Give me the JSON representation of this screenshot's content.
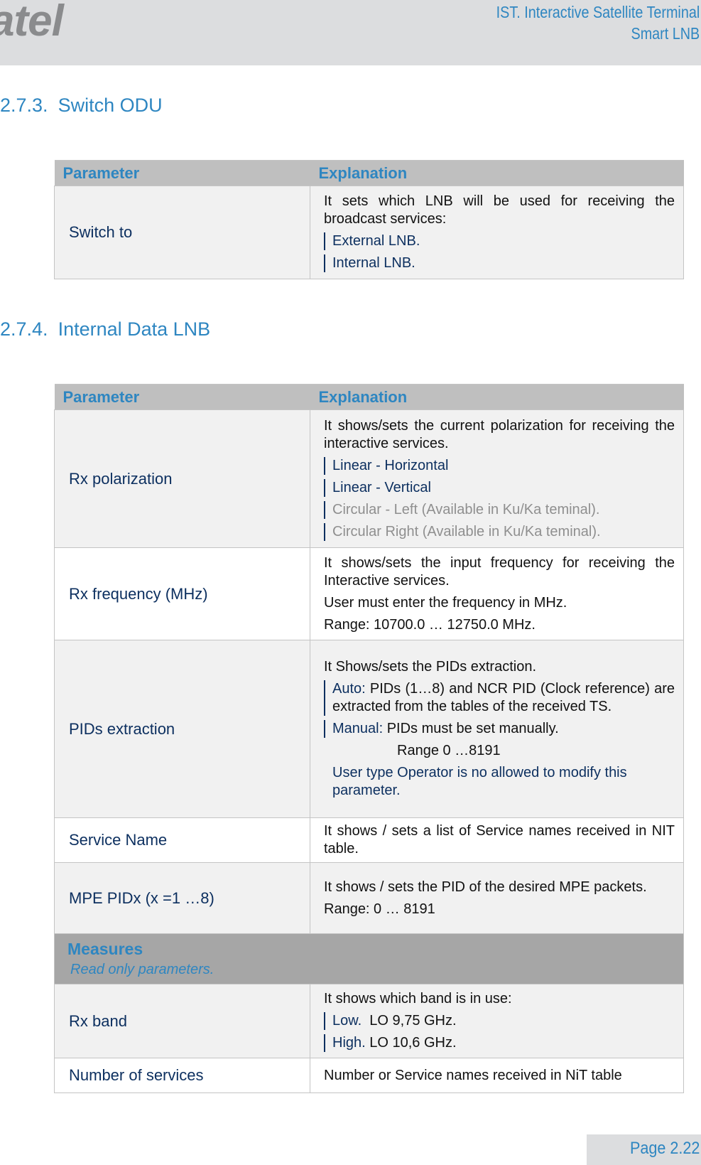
{
  "header": {
    "logo_text": "atel",
    "doc_title_line1": "IST. Interactive Satellite Terminal",
    "doc_title_line2": "Smart LNB"
  },
  "section1": {
    "number": "2.7.3.",
    "title": "Switch ODU",
    "table": {
      "col_param": "Parameter",
      "col_expl": "Explanation",
      "rows": [
        {
          "param": "Switch to",
          "desc": "It sets which LNB will be used for receiving the broadcast services:",
          "options": [
            "External LNB.",
            "Internal LNB."
          ]
        }
      ]
    }
  },
  "section2": {
    "number": "2.7.4.",
    "title": "Internal Data LNB",
    "table": {
      "col_param": "Parameter",
      "col_expl": "Explanation",
      "rows": [
        {
          "param": "Rx polarization",
          "desc": "It shows/sets the current polarization for receiving the interactive services.",
          "options": [
            "Linear - Horizontal",
            "Linear - Vertical"
          ],
          "disabled_options": [
            "Circular - Left (Available in Ku/Ka teminal).",
            "Circular Right (Available in Ku/Ka teminal)."
          ]
        },
        {
          "param": "Rx frequency (MHz)",
          "desc": "It shows/sets the input frequency for receiving the Interactive services.",
          "line2": "User must enter the frequency in MHz.",
          "line3": "Range: 10700.0 … 12750.0 MHz."
        },
        {
          "param": "PIDs extraction",
          "desc": "It Shows/sets the PIDs extraction.",
          "auto_label": "Auto:",
          "auto_text": "PIDs (1…8) and NCR PID (Clock reference) are extracted from the tables of the received TS.",
          "manual_label": "Manual:",
          "manual_text": "PIDs must be set manually.",
          "range": "Range 0 …8191",
          "note": "User type Operator is no allowed to modify this parameter."
        },
        {
          "param": "Service Name",
          "desc": "It shows / sets a list of Service names received in NIT table."
        },
        {
          "param": "MPE PIDx (x =1 …8)",
          "desc": "It shows / sets the PID of the desired MPE packets.",
          "line2": "Range: 0 … 8191"
        }
      ],
      "measures": {
        "title": "Measures",
        "subtitle": "Read only parameters."
      },
      "measure_rows": [
        {
          "param": "Rx band",
          "desc": "It shows which band is in use:",
          "low_label": "Low.",
          "low_text": "LO 9,75 GHz.",
          "high_label": "High.",
          "high_text": "LO 10,6 GHz."
        },
        {
          "param": "Number of services",
          "desc": "Number or Service names received in NiT table"
        }
      ]
    }
  },
  "footer": {
    "page": "Page 2.22"
  }
}
